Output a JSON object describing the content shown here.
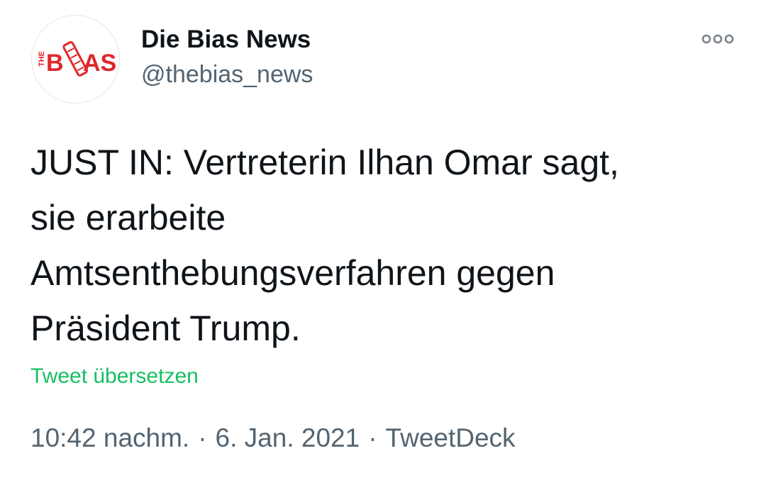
{
  "author": {
    "display_name": "Die Bias News",
    "handle": "@thebias_news",
    "avatar_logo_text": "THE BIAS",
    "avatar_colors": {
      "logo": "#e0282b",
      "background": "#ffffff"
    }
  },
  "menu": {
    "icon": "more-options-icon"
  },
  "tweet": {
    "text": "JUST IN: Vertreterin Ilhan Omar sagt,\nsie erarbeite\nAmtsenthebungsverfahren gegen\nPräsident Trump.",
    "translate_label": "Tweet übersetzen"
  },
  "meta": {
    "time": "10:42 nachm.",
    "separator": "·",
    "date": "6. Jan. 2021",
    "source": "TweetDeck"
  },
  "colors": {
    "text_primary": "#0f1419",
    "text_secondary": "#536471",
    "translate_link": "#17bf63",
    "brand_red": "#e0282b"
  }
}
